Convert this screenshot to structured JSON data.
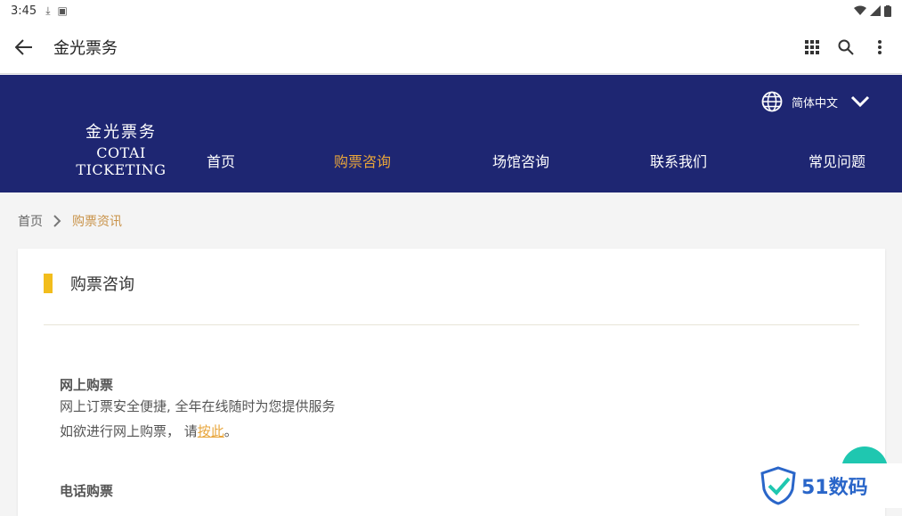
{
  "status_bar": {
    "time": "3:45",
    "icons": [
      "download-icon",
      "photo-icon"
    ],
    "right_icons": [
      "wifi-icon",
      "signal-icon",
      "battery-icon"
    ]
  },
  "app_bar": {
    "title": "金光票务",
    "back_icon": "arrow-left-icon",
    "actions": [
      "grid-icon",
      "search-icon",
      "more-vert-icon"
    ]
  },
  "header": {
    "logo_cn": "金光票务",
    "logo_en": "COTAI TICKETING",
    "language": "简体中文",
    "nav": [
      {
        "label": "首页",
        "active": false
      },
      {
        "label": "购票咨询",
        "active": true
      },
      {
        "label": "场馆咨询",
        "active": false
      },
      {
        "label": "联系我们",
        "active": false
      },
      {
        "label": "常见问题",
        "active": false
      }
    ],
    "colors": {
      "background": "#1e2672",
      "active": "#e8a53a"
    }
  },
  "breadcrumb": {
    "home": "首页",
    "current": "购票资讯"
  },
  "card": {
    "title": "购票咨询",
    "sections": [
      {
        "heading": "网上购票",
        "line1": "网上订票安全便捷, 全年在线随时为您提供服务",
        "line2_prefix": "如欲进行网上购票， 请",
        "line2_link": "按此",
        "line2_suffix": "。"
      },
      {
        "heading": "电话购票"
      }
    ]
  },
  "watermark": {
    "text": "51数码"
  }
}
